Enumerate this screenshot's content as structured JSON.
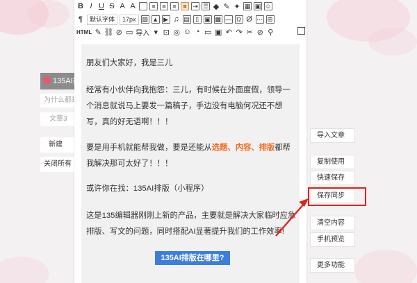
{
  "left_panel": {
    "header": "135AI排",
    "search_placeholder": "为什么都是",
    "article_field": "文章3",
    "new_button": "新建",
    "close_all_button": "关闭所有"
  },
  "toolbar": {
    "font_family": "默认字体",
    "font_size": "17px",
    "html_label": "HTML",
    "import_label": "导入"
  },
  "document": {
    "lines": [
      "朋友们大家好，我是三儿",
      "经常有小伙伴向我抱怨：三儿，有时候在外面度假，领导一",
      "个消息就说马上要发一篇稿子，手边没有电脑何况还不想",
      "写，真的好无语啊！！！",
      "要是用手机就能帮我做，要是还能从",
      "帮",
      "我解决那可太好了！！！",
      "或许你在找：135AI排版（小程序）",
      "这是135编辑器刚刚上新的产品，主要就是解决大家临时应急",
      "排版、写文的问题，同时搭配AI显著提升我们的工作效率!"
    ],
    "highlight_1": "选题",
    "sep_1": "、",
    "highlight_2": "内容",
    "sep_2": "、",
    "highlight_3": "排版",
    "after_highlight": "都",
    "section_tag": "135AI排版在哪里?"
  },
  "right_panel": {
    "import_article": "导入文章",
    "copy_use": "复制使用",
    "quick_save": "快速保存",
    "save_sync": "保存同步",
    "clear_content": "清空内容",
    "mobile_preview": "手机预览",
    "more_functions": "更多功能"
  },
  "colors": {
    "accent": "#3d7edc",
    "highlight": "#f56a1f",
    "annotation": "#e3211b"
  }
}
